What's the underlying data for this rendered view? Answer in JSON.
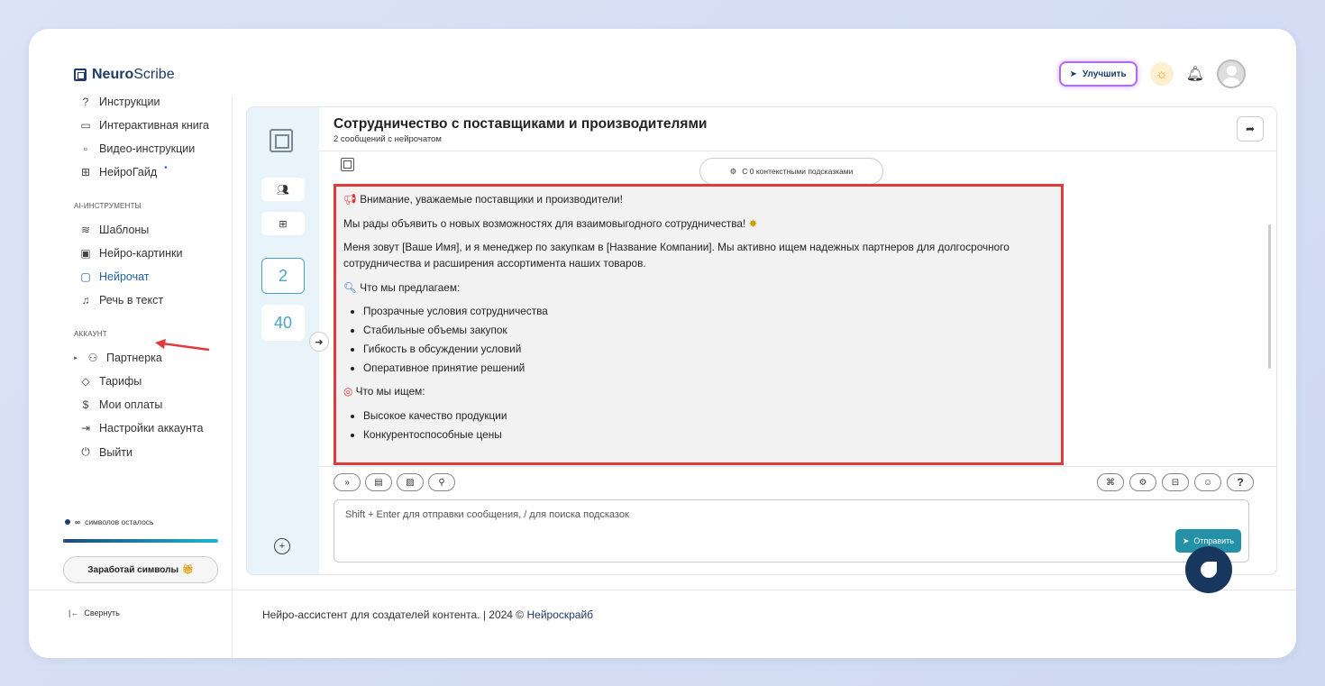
{
  "brand": {
    "bold": "Neuro",
    "rest": "Scribe"
  },
  "topbar": {
    "upgrade_label": "Улучшить"
  },
  "sidebar": {
    "help_items": [
      {
        "icon": "question-icon",
        "label": "Инструкции"
      },
      {
        "icon": "book-icon",
        "label": "Интерактивная книга"
      },
      {
        "icon": "video-icon",
        "label": "Видео-инструкции"
      },
      {
        "icon": "guide-icon",
        "label": "НейроГайд"
      }
    ],
    "ai_section": "AI-ИНСТРУМЕНТЫ",
    "ai_items": [
      {
        "icon": "layers-icon",
        "label": "Шаблоны"
      },
      {
        "icon": "image-icon",
        "label": "Нейро-картинки"
      },
      {
        "icon": "chat-icon",
        "label": "Нейрочат"
      },
      {
        "icon": "headphones-icon",
        "label": "Речь в текст"
      }
    ],
    "account_section": "АККАУНТ",
    "account_items": [
      {
        "icon": "users-icon",
        "label": "Партнерка"
      },
      {
        "icon": "tag-icon",
        "label": "Тарифы"
      },
      {
        "icon": "dollar-icon",
        "label": "Мои оплаты"
      },
      {
        "icon": "login-icon",
        "label": "Настройки аккаунта"
      },
      {
        "icon": "power-icon",
        "label": "Выйти"
      }
    ],
    "symbols_infinity": "∞",
    "symbols_label": "символов осталось",
    "earn_label": "Заработай символы",
    "collapse_label": "Свернуть"
  },
  "chat": {
    "title": "Сотрудничество с поставщиками и производителями",
    "subtitle": "2 сообщений с нейрочатом",
    "context_label": "С 0 контекстными подсказками",
    "rail_counts": [
      "2",
      "40"
    ],
    "message": {
      "p1": "Внимание, уважаемые поставщики и производители!",
      "p2": "Мы рады объявить о новых возможностях для взаимовыгодного сотрудничества!",
      "p3": "Меня зовут [Ваше Имя], и я менеджер по закупкам в [Название Компании]. Мы активно ищем надежных партнеров для долгосрочного сотрудничества и расширения ассортимента наших товаров.",
      "h1": "Что мы предлагаем:",
      "offer": [
        "Прозрачные условия сотрудничества",
        "Стабильные объемы закупок",
        "Гибкость в обсуждении условий",
        "Оперативное принятие решений"
      ],
      "h2": "Что мы ищем:",
      "seek": [
        "Высокое качество продукции",
        "Конкурентоспособные цены"
      ]
    },
    "input_placeholder": "Shift + Enter для отправки сообщения, / для поиска подсказок",
    "send_label": "Отправить"
  },
  "footer": {
    "text": "Нейро-ассистент для создателей контента.  | 2024 © ",
    "link": "Нейроскрайб"
  }
}
